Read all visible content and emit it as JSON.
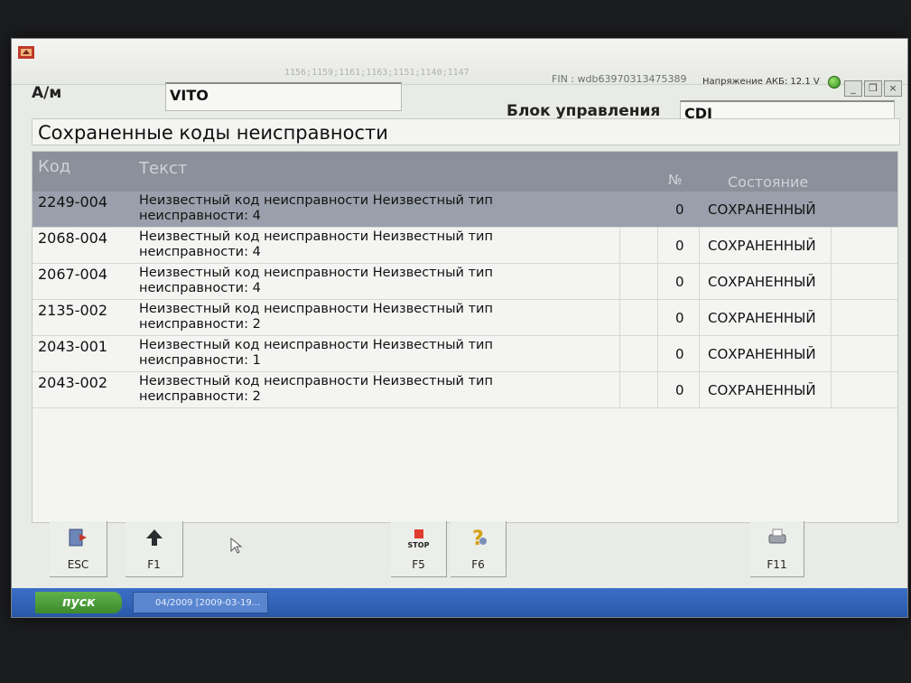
{
  "titlebar": {
    "ecu_list": "1156;1159;1161;1163;1151;1140;1147",
    "fin": "FIN : wdb63970313475389",
    "voltage": "Напряжение АКБ: 12.1 V",
    "minimize": "_",
    "restore": "❐",
    "close": "×"
  },
  "vehicle": {
    "label": "А/м",
    "value": "VITO"
  },
  "ecu": {
    "label": "Блок управления",
    "value": "CDI"
  },
  "section_title": "Сохраненные коды неисправности",
  "table": {
    "headers": {
      "code": "Код",
      "text": "Текст",
      "num": "№",
      "state": "Состояние"
    },
    "rows": [
      {
        "code": "2249-004",
        "text": "Неизвестный код неисправности Неизвестный тип неисправности: 4",
        "num": "0",
        "state": "СОХРАНЕННЫЙ",
        "selected": true
      },
      {
        "code": "2068-004",
        "text": "Неизвестный код неисправности Неизвестный тип неисправности: 4",
        "num": "0",
        "state": "СОХРАНЕННЫЙ"
      },
      {
        "code": "2067-004",
        "text": "Неизвестный код неисправности Неизвестный тип неисправности: 4",
        "num": "0",
        "state": "СОХРАНЕННЫЙ"
      },
      {
        "code": "2135-002",
        "text": "Неизвестный код неисправности Неизвестный тип неисправности: 2",
        "num": "0",
        "state": "СОХРАНЕННЫЙ"
      },
      {
        "code": "2043-001",
        "text": "Неизвестный код неисправности Неизвестный тип неисправности: 1",
        "num": "0",
        "state": "СОХРАНЕННЫЙ"
      },
      {
        "code": "2043-002",
        "text": "Неизвестный код неисправности Неизвестный тип неисправности: 2",
        "num": "0",
        "state": "СОХРАНЕННЫЙ"
      }
    ]
  },
  "fkeys": [
    {
      "key": "ESC",
      "icon": "exit-door-icon"
    },
    {
      "key": "F1",
      "icon": "arrow-up-icon"
    },
    {
      "key": "F5",
      "icon": "stop-icon",
      "sub": "STOP"
    },
    {
      "key": "F6",
      "icon": "help-question-icon"
    },
    {
      "key": "F11",
      "icon": "printer-icon"
    }
  ],
  "taskbar": {
    "start": "пуск",
    "task": "04/2009 [2009-03-19..."
  },
  "colors": {
    "header": "#8b909a",
    "selected_row": "#9aa0ab",
    "taskbar": "#2a58a8",
    "start": "#3d8a2c"
  }
}
